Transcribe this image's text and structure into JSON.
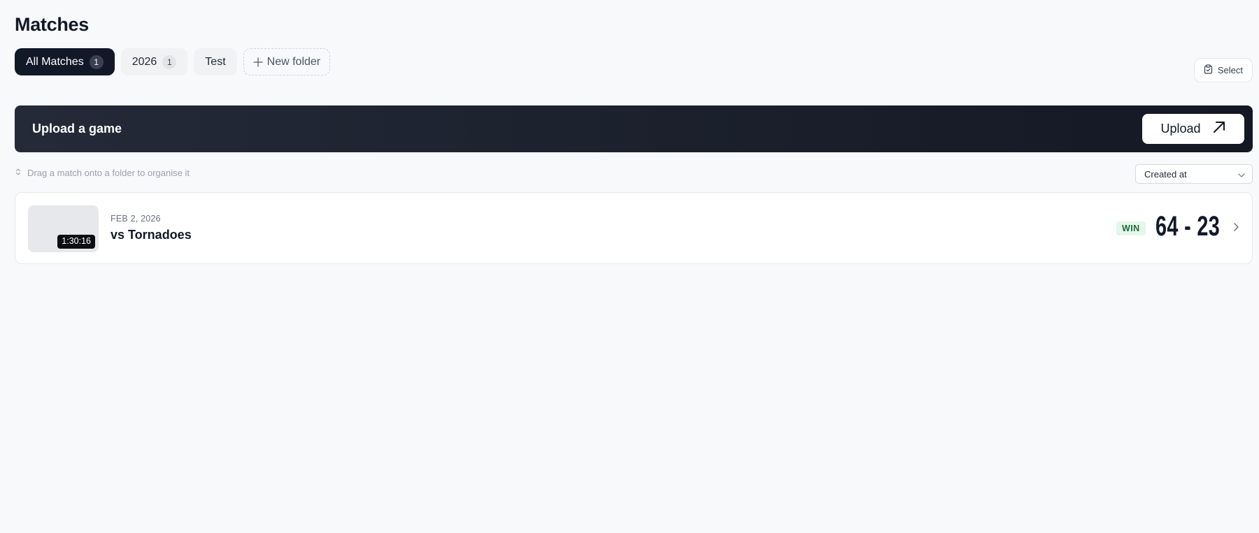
{
  "page": {
    "title": "Matches"
  },
  "folders": [
    {
      "label": "All Matches",
      "count": "1",
      "active": true
    },
    {
      "label": "2026",
      "count": "1",
      "active": false
    },
    {
      "label": "Test",
      "count": "",
      "active": false
    }
  ],
  "new_folder_label": "New folder",
  "select_label": "Select",
  "upload_banner": {
    "title": "Upload a game",
    "button_label": "Upload"
  },
  "hint_text": "Drag a match onto a folder to organise it",
  "sort": {
    "selected": "Created at"
  },
  "matches": [
    {
      "date": "FEB 2, 2026",
      "opponent": "vs Tornadoes",
      "duration": "1:30:16",
      "result": "WIN",
      "score": "64 - 23"
    }
  ],
  "colors": {
    "background": "#f8f9fb",
    "active_tab": "#111827",
    "banner": "#1a1f2b",
    "win_badge_bg": "#e5f6ea",
    "win_badge_text": "#1f6b3a"
  },
  "icons": {
    "new_folder": "plus-icon",
    "select": "clipboard-check-icon",
    "upload": "arrow-up-right-icon",
    "hint": "drag-handle-icon",
    "sort": "chevron-down-icon",
    "open_match": "chevron-right-icon"
  }
}
